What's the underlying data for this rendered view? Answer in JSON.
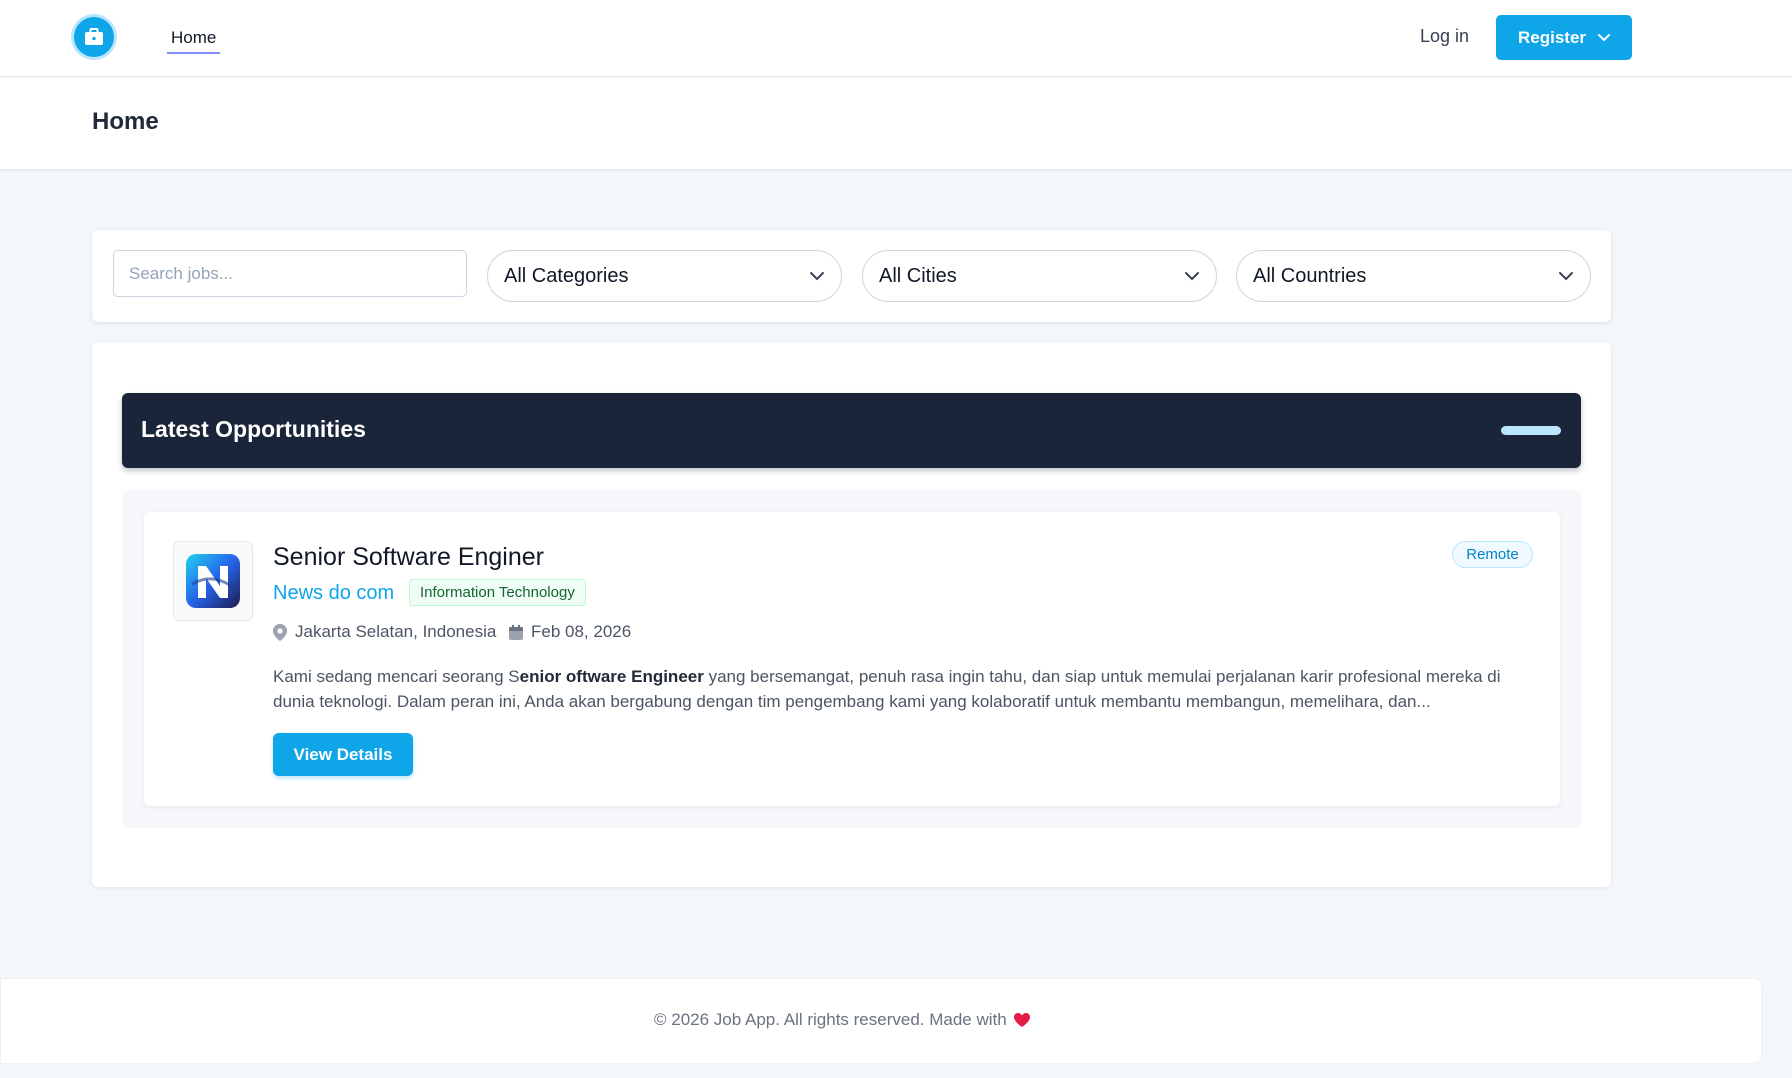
{
  "nav": {
    "home_label": "Home",
    "login_label": "Log in",
    "register_label": "Register"
  },
  "header": {
    "title": "Home"
  },
  "filters": {
    "search_placeholder": "Search jobs...",
    "category": "All Categories",
    "city": "All Cities",
    "country": "All Countries"
  },
  "listing": {
    "title": "Latest Opportunities",
    "jobs": [
      {
        "title": "Senior Software Enginer",
        "company": "News do com",
        "category": "Information Technology",
        "location": "Jakarta Selatan, Indonesia",
        "date": "Feb 08, 2026",
        "work_type": "Remote",
        "description_prefix": "Kami sedang mencari seorang S",
        "description_bold": "enior oftware Engineer",
        "description_line1_rest": " yang bersemangat, penuh rasa ingin tahu, dan siap untuk memulai perjalanan karir profesional mereka di",
        "description_line2": "dunia teknologi. Dalam peran ini, Anda akan bergabung dengan tim pengembang kami yang kolaboratif untuk membantu membangun, memelihara, dan...",
        "button_label": "View Details"
      }
    ]
  },
  "footer": {
    "text": "© 2026 Job App. All rights reserved. Made with"
  },
  "colors": {
    "accent": "#0ea5e9",
    "banner": "#1a2539",
    "heart": "#e11d48"
  }
}
